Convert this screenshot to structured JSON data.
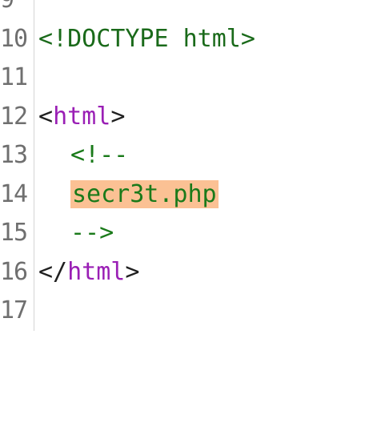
{
  "lines": [
    {
      "number": "9"
    },
    {
      "number": "10",
      "doctype": "<!DOCTYPE html>"
    },
    {
      "number": "11"
    },
    {
      "number": "12",
      "open_bracket": "<",
      "tag": "html",
      "close_bracket": ">"
    },
    {
      "number": "13",
      "comment": "<!--"
    },
    {
      "number": "14",
      "comment": "secr3t.php"
    },
    {
      "number": "15",
      "comment": "-->"
    },
    {
      "number": "16",
      "open_bracket": "</",
      "tag": "html",
      "close_bracket": ">"
    },
    {
      "number": "17"
    }
  ],
  "colors": {
    "comment": "#1a7a1a",
    "tag": "#9a1fb5",
    "highlight": "#fbc194",
    "line_number": "#6f6f6f"
  }
}
